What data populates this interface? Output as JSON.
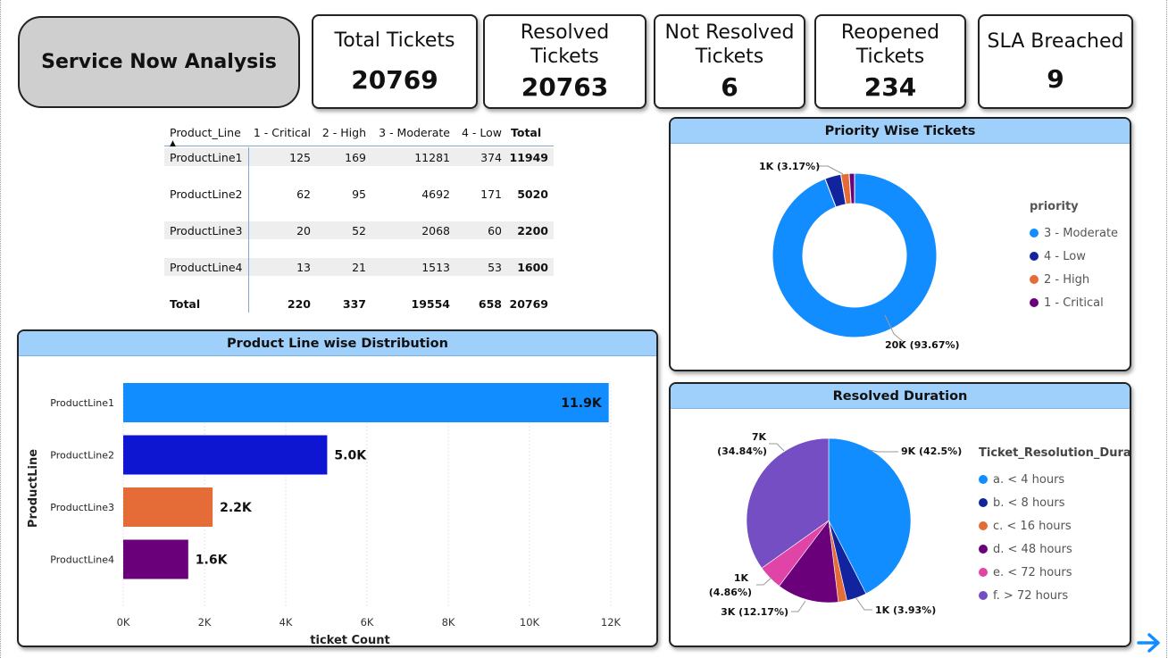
{
  "title": "Service Now Analysis",
  "kpis": {
    "total": {
      "label": "Total Tickets",
      "value": "20769"
    },
    "resolved": {
      "label": "Resolved Tickets",
      "value": "20763"
    },
    "not_resolved": {
      "label": "Not Resolved Tickets",
      "value": "6"
    },
    "reopened": {
      "label": "Reopened Tickets",
      "value": "234"
    },
    "sla": {
      "label": "SLA Breached",
      "value": "9"
    }
  },
  "matrix": {
    "headers": [
      "Product_Line",
      "1 - Critical",
      "2 - High",
      "3 - Moderate",
      "4 - Low",
      "Total"
    ],
    "rows": [
      [
        "ProductLine1",
        "125",
        "169",
        "11281",
        "374",
        "11949"
      ],
      [
        "ProductLine2",
        "62",
        "95",
        "4692",
        "171",
        "5020"
      ],
      [
        "ProductLine3",
        "20",
        "52",
        "2068",
        "60",
        "2200"
      ],
      [
        "ProductLine4",
        "13",
        "21",
        "1513",
        "53",
        "1600"
      ]
    ],
    "total": [
      "Total",
      "220",
      "337",
      "19554",
      "658",
      "20769"
    ]
  },
  "bar_panel": {
    "title": "Product Line wise Distribution",
    "ylabel": "ProductLine",
    "xlabel": "ticket Count"
  },
  "donut_panel": {
    "title": "Priority Wise Tickets",
    "legend_title": "priority",
    "legend": [
      "3 - Moderate",
      "4 - Low",
      "2 - High",
      "1 - Critical"
    ]
  },
  "pie_panel": {
    "title": "Resolved Duration",
    "legend_title": "Ticket_Resolution_Durat...",
    "legend": [
      "a. < 4 hours",
      "b. < 8 hours",
      "c. < 16 hours",
      "d. < 48 hours",
      "e. < 72 hours",
      "f. > 72 hours"
    ]
  },
  "colors": {
    "blue": "#118dff",
    "dark_blue": "#12239e",
    "bar_blue2": "#0f16d1",
    "orange": "#e66c37",
    "purple": "#6b007b",
    "pink": "#e044a7",
    "violet": "#744ec2"
  },
  "chart_data": [
    {
      "type": "bar",
      "orientation": "horizontal",
      "categories": [
        "ProductLine1",
        "ProductLine2",
        "ProductLine3",
        "ProductLine4"
      ],
      "values": [
        11949,
        5020,
        2200,
        1600
      ],
      "data_labels": [
        "11.9K",
        "5.0K",
        "2.2K",
        "1.6K"
      ],
      "xlabel": "ticket Count",
      "ylabel": "ProductLine",
      "xlim": [
        0,
        12000
      ],
      "xticks": [
        "0K",
        "2K",
        "4K",
        "6K",
        "8K",
        "10K",
        "12K"
      ],
      "grid": true
    },
    {
      "type": "pie",
      "variant": "donut",
      "categories": [
        "3 - Moderate",
        "4 - Low",
        "2 - High",
        "1 - Critical"
      ],
      "values": [
        19554,
        658,
        337,
        220
      ],
      "data_labels": [
        "20K (93.67%)",
        "",
        "1K (3.17%)",
        ""
      ],
      "legend_title": "priority",
      "legend": "right"
    },
    {
      "type": "pie",
      "categories": [
        "a. < 4 hours",
        "b. < 8 hours",
        "c. < 16 hours",
        "d. < 48 hours",
        "e. < 72 hours",
        "f. > 72 hours"
      ],
      "values": [
        42.5,
        3.93,
        1.7,
        12.17,
        4.86,
        34.84
      ],
      "data_labels": [
        "9K (42.5%)",
        "1K (3.93%)",
        "",
        "3K (12.17%)",
        "1K (4.86%)",
        "7K (34.84%)"
      ],
      "legend_title": "Ticket_Resolution_Durat...",
      "legend": "right"
    }
  ]
}
